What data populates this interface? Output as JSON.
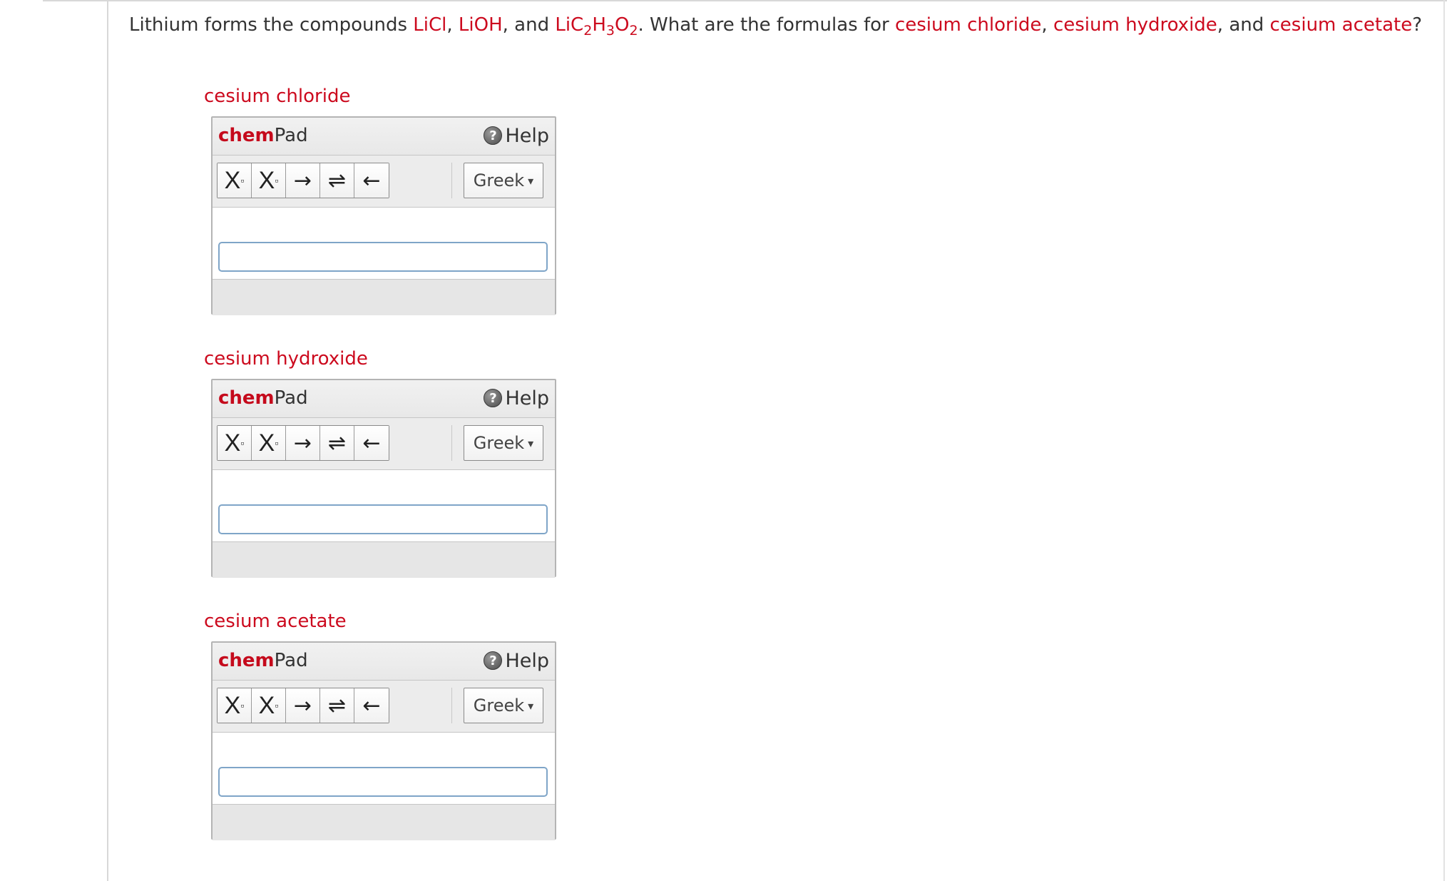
{
  "question": {
    "intro": "Lithium forms the compounds ",
    "c1": "LiCl",
    "sep1": ", ",
    "c2": "LiOH",
    "sep2": ", and ",
    "c3_base": "LiC",
    "c3_sub1": "2",
    "c3_h": "H",
    "c3_sub2": "3",
    "c3_o": "O",
    "c3_sub3": "2",
    "mid": ". What are the formulas for ",
    "q1": "cesium chloride",
    "sep3": ", ",
    "q2": "cesium hydroxide",
    "sep4": ", and ",
    "q3": "cesium acetate",
    "end": "?"
  },
  "chempad_common": {
    "brand_bold": "chem",
    "brand_rest": "Pad",
    "help_label": "Help",
    "help_icon_glyph": "?",
    "subscript_label": "X",
    "superscript_label": "X",
    "box_glyph": "▫",
    "arrow_right": "→",
    "arrow_equilibrium": "⇌",
    "arrow_left": "←",
    "greek_label": "Greek",
    "caret_glyph": "▾",
    "icons": [
      "help-icon",
      "subscript-icon",
      "superscript-icon",
      "reaction-arrow-icon",
      "equilibrium-arrow-icon",
      "reverse-arrow-icon",
      "chevron-down-icon"
    ]
  },
  "parts": [
    {
      "label": "cesium chloride",
      "value": "",
      "placeholder": ""
    },
    {
      "label": "cesium hydroxide",
      "value": "",
      "placeholder": ""
    },
    {
      "label": "cesium acetate",
      "value": "",
      "placeholder": ""
    }
  ],
  "colors": {
    "highlight": "#cc0a1e",
    "input_border": "#7fa5c8"
  }
}
